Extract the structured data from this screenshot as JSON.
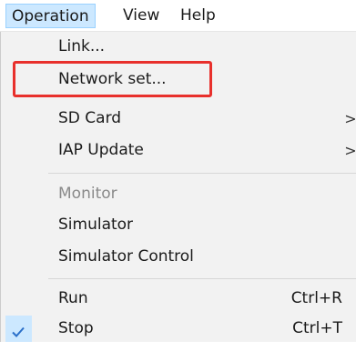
{
  "menubar": {
    "items": [
      {
        "label": "Operation",
        "active": true
      },
      {
        "label": "View",
        "active": false
      },
      {
        "label": "Help",
        "active": false
      }
    ]
  },
  "menu": {
    "items": [
      {
        "label": "Link...",
        "shortcut": "",
        "submenu": false,
        "enabled": true,
        "checked": false
      },
      {
        "label": "Network set...",
        "shortcut": "",
        "submenu": false,
        "enabled": true,
        "checked": false
      },
      {
        "label": "SD Card",
        "shortcut": "",
        "submenu": true,
        "enabled": true,
        "checked": false
      },
      {
        "label": "IAP Update",
        "shortcut": "",
        "submenu": true,
        "enabled": true,
        "checked": false
      },
      {
        "label": "Monitor",
        "shortcut": "",
        "submenu": false,
        "enabled": false,
        "checked": false
      },
      {
        "label": "Simulator",
        "shortcut": "",
        "submenu": false,
        "enabled": true,
        "checked": false
      },
      {
        "label": "Simulator Control",
        "shortcut": "",
        "submenu": false,
        "enabled": true,
        "checked": false
      },
      {
        "label": "Run",
        "shortcut": "Ctrl+R",
        "submenu": false,
        "enabled": true,
        "checked": false
      },
      {
        "label": "Stop",
        "shortcut": "Ctrl+T",
        "submenu": false,
        "enabled": true,
        "checked": true
      }
    ],
    "submenu_arrow": ">",
    "check_icon": "checkmark-icon"
  },
  "colors": {
    "menubar_active_bg": "#cce8ff",
    "menubar_active_border": "#99d1ff",
    "menu_bg": "#f2f2f2",
    "highlight_annotation": "#e8302c",
    "disabled_text": "#8a8a8a",
    "check_color": "#2a6fc9"
  }
}
